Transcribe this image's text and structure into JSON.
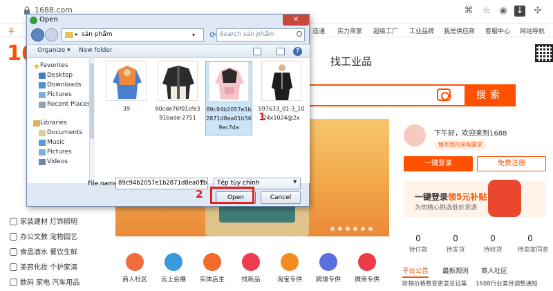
{
  "browser": {
    "url": "1688.com",
    "bookmarks": [
      "手",
      "造通",
      "实力商家",
      "超级工厂",
      "工业品牌",
      "我是供应商",
      "客服中心",
      "网站导航"
    ]
  },
  "page": {
    "logo": "16",
    "gongye_title": "找工业品",
    "search_button": "搜索",
    "left_categories": [
      {
        "icon": "home-icon",
        "label": "家装建材 灯饰照明"
      },
      {
        "icon": "office-icon",
        "label": "办公文教 宠物园艺"
      },
      {
        "icon": "food-icon",
        "label": "食品酒水 餐饮生鲜"
      },
      {
        "icon": "cosmetic-icon",
        "label": "美容化妆 个护家清"
      },
      {
        "icon": "camera-icon",
        "label": "数码 家电 汽车用品"
      }
    ],
    "shortcuts": [
      {
        "label": "商人社区",
        "color": "#f26b3a"
      },
      {
        "label": "云上会展",
        "color": "#3a9ae0"
      },
      {
        "label": "实体店主",
        "color": "#f36a2a"
      },
      {
        "label": "找新品",
        "color": "#ef3b4f"
      },
      {
        "label": "淘宝专供",
        "color": "#f58a1f"
      },
      {
        "label": "跨境专供",
        "color": "#5a6fe0"
      },
      {
        "label": "微商专供",
        "color": "#ef3a4a"
      }
    ],
    "greeting": "下午好，欢迎来到1688",
    "need_tag": "填写我的采购需求",
    "login_button": "一键登录",
    "register_button": "免费注册",
    "promo_title_a": "一键登录",
    "promo_title_b": "领5元补贴",
    "promo_subtitle": "为你精心挑选低价货源",
    "counts": [
      {
        "value": "0",
        "label": "待付款"
      },
      {
        "value": "0",
        "label": "待发货"
      },
      {
        "value": "0",
        "label": "待收货"
      },
      {
        "value": "0",
        "label": "待卖家同意"
      }
    ],
    "notice_tabs": [
      "平台公告",
      "最新规则",
      "商人社区"
    ],
    "notice_lines": [
      "阶梯价格数变更意见征集",
      "1688行业类目调整通知"
    ]
  },
  "dialog": {
    "title": "Open",
    "path": "sản phẩm",
    "search_placeholder": "Search sản phẩm",
    "toolbar": {
      "organize": "Organize ▾",
      "new_folder": "New folder"
    },
    "nav": [
      {
        "label": "Favorites",
        "icon": "star-icon",
        "indent": 0
      },
      {
        "label": "Desktop",
        "icon": "desktop-icon",
        "indent": 1
      },
      {
        "label": "Downloads",
        "icon": "downloads-icon",
        "indent": 1
      },
      {
        "label": "Pictures",
        "icon": "pictures-icon",
        "indent": 1
      },
      {
        "label": "Recent Places",
        "icon": "recent-places-icon",
        "indent": 1
      },
      {
        "label": "Libraries",
        "icon": "libraries-icon",
        "indent": 0
      },
      {
        "label": "Documents",
        "icon": "documents-icon",
        "indent": 1
      },
      {
        "label": "Music",
        "icon": "music-icon",
        "indent": 1
      },
      {
        "label": "Pictures",
        "icon": "pictures-icon",
        "indent": 1
      },
      {
        "label": "Videos",
        "icon": "videos-icon",
        "indent": 1
      }
    ],
    "files": [
      {
        "name": "39",
        "selected": false
      },
      {
        "name": "80cde76f01cfe391bade-2751",
        "selected": false
      },
      {
        "name": "89c94b2057e1b2871d8ea01b569ec7da",
        "selected": true
      },
      {
        "name": "597633_01-3_1024x1024@2x",
        "selected": false
      }
    ],
    "file_name_label": "File name:",
    "file_name_value": "89c94b2057e1b2871d8ea01b569ec7",
    "file_type": "Tệp tùy chỉnh",
    "open_button": "Open",
    "cancel_button": "Cancel",
    "help": "?",
    "close": "✕"
  },
  "annotations": {
    "step1": "1",
    "step2": "2"
  }
}
